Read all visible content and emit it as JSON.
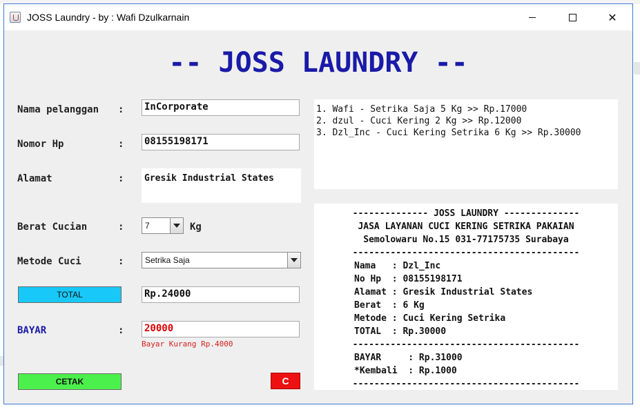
{
  "window": {
    "title": "JOSS Laundry - by : Wafi Dzulkarnain",
    "controls": {
      "minimize": "minimize-icon",
      "maximize": "maximize-icon",
      "close": "close-icon"
    }
  },
  "heading": "-- JOSS LAUNDRY --",
  "form": {
    "nama_label": "Nama pelanggan",
    "nama_value": "InCorporate",
    "hp_label": "Nomor Hp",
    "hp_value": "08155198171",
    "alamat_label": "Alamat",
    "alamat_value": "Gresik Industrial States",
    "berat_label": "Berat Cucian",
    "berat_value": "7",
    "berat_unit": "Kg",
    "metode_label": "Metode Cuci",
    "metode_value": "Setrika Saja",
    "total_button": "TOTAL",
    "total_value": "Rp.24000",
    "bayar_label": "BAYAR",
    "bayar_value": "20000",
    "bayar_warning": "Bayar Kurang Rp.4000",
    "cetak_button": "CETAK",
    "clear_button": "C",
    "colon": ":"
  },
  "history": [
    "1. Wafi - Setrika Saja 5 Kg >> Rp.17000",
    "2. dzul - Cuci Kering 2 Kg >> Rp.12000",
    "3. Dzl_Inc - Cuci Kering Setrika 6 Kg >> Rp.30000"
  ],
  "receipt": {
    "header": "-------------- JOSS LAUNDRY --------------",
    "tagline": "JASA LAYANAN CUCI KERING SETRIKA PAKAIAN",
    "address": "Semolowaru No.15 031-77175735 Surabaya",
    "divider": "------------------------------------------",
    "lines": [
      "Nama   : Dzl_Inc",
      "No Hp  : 08155198171",
      "Alamat : Gresik Industrial States",
      "Berat  : 6 Kg",
      "Metode : Cuci Kering Setrika",
      "TOTAL  : Rp.30000"
    ],
    "payment": [
      "BAYAR     : Rp.31000",
      "*Kembali  : Rp.1000"
    ]
  },
  "colors": {
    "heading": "#1a1aa8",
    "total_button": "#18c8f8",
    "cetak_button": "#4cf04c",
    "clear_button": "#ee1111",
    "bayar_text": "#dd0000",
    "warning": "#d42020"
  }
}
